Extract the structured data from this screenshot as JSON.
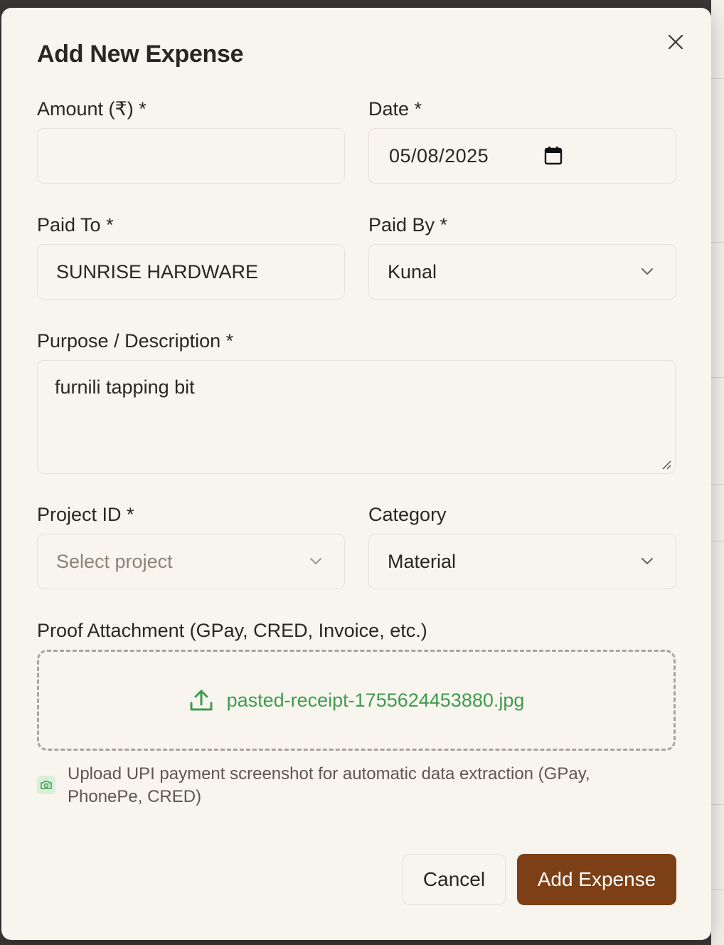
{
  "modal": {
    "title": "Add New Expense"
  },
  "form": {
    "amount": {
      "label": "Amount (₹) *",
      "value": ""
    },
    "date": {
      "label": "Date *",
      "value": "05/08/2025"
    },
    "paid_to": {
      "label": "Paid To *",
      "value": "SUNRISE HARDWARE"
    },
    "paid_by": {
      "label": "Paid By *",
      "selected": "Kunal"
    },
    "description": {
      "label": "Purpose / Description *",
      "value": "furnili tapping bit"
    },
    "project_id": {
      "label": "Project ID *",
      "placeholder": "Select project"
    },
    "category": {
      "label": "Category",
      "selected": "Material"
    },
    "proof": {
      "label": "Proof Attachment (GPay, CRED, Invoice, etc.)",
      "file_name": "pasted-receipt-1755624453880.jpg",
      "hint": "Upload UPI payment screenshot for automatic data extraction (GPay, PhonePe, CRED)"
    }
  },
  "actions": {
    "cancel_label": "Cancel",
    "submit_label": "Add Expense"
  },
  "colors": {
    "accent": "#7d3f15",
    "success": "#3f9b4f",
    "background": "#f8f5ee"
  },
  "icons": [
    "close-icon",
    "calendar-icon",
    "chevron-down-icon",
    "upload-icon",
    "camera-icon",
    "resize-handle-icon"
  ]
}
